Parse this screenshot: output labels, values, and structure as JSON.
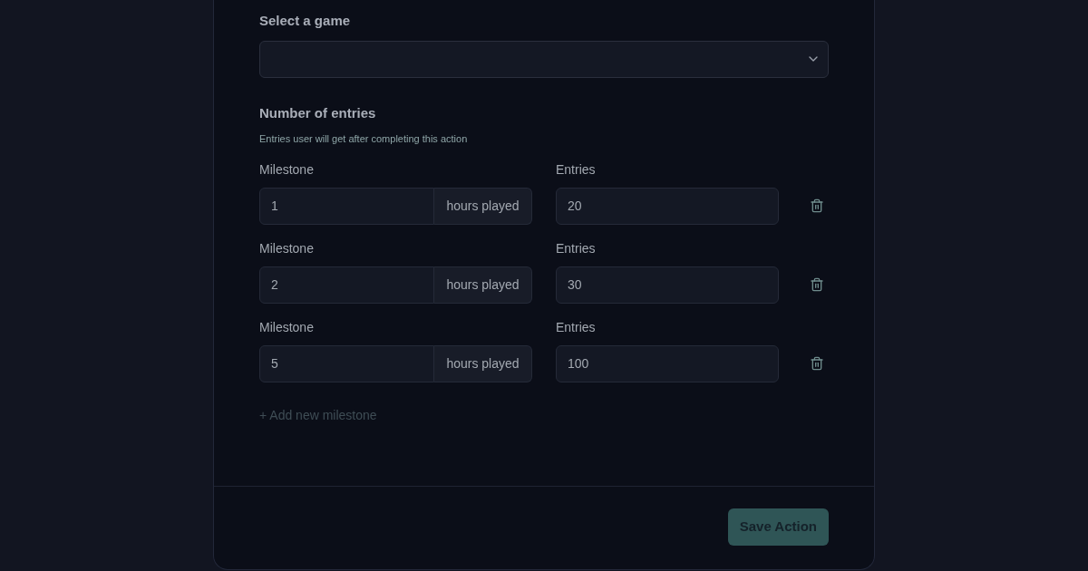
{
  "game_select": {
    "label": "Select a game"
  },
  "entries_section": {
    "title": "Number of entries",
    "subtitle": "Entries user will get after completing this action"
  },
  "milestones": [
    {
      "milestone_label": "Milestone",
      "milestone": "1",
      "unit": "hours played",
      "entries_label": "Entries",
      "entries": "20"
    },
    {
      "milestone_label": "Milestone",
      "milestone": "2",
      "unit": "hours played",
      "entries_label": "Entries",
      "entries": "30"
    },
    {
      "milestone_label": "Milestone",
      "milestone": "5",
      "unit": "hours played",
      "entries_label": "Entries",
      "entries": "100"
    }
  ],
  "add_link": "+ Add new milestone",
  "save_button": "Save Action"
}
